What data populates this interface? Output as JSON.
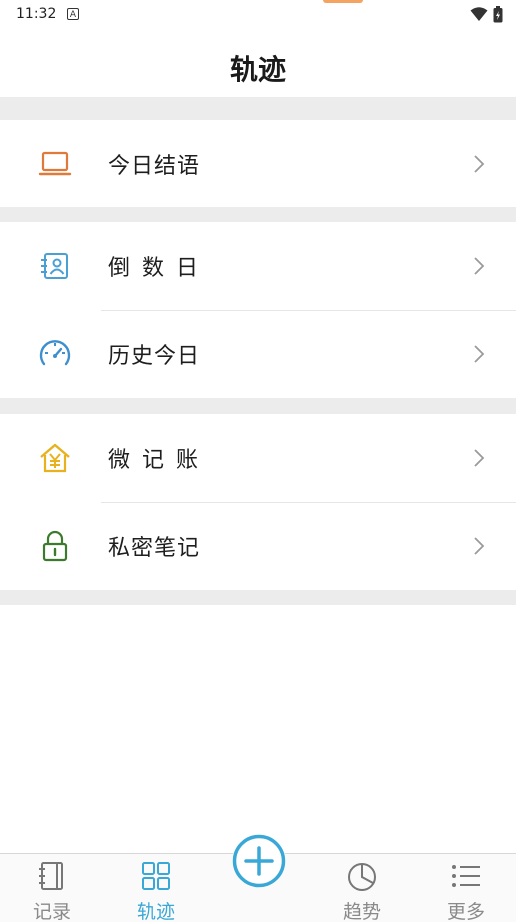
{
  "status": {
    "time": "11:32",
    "notify_glyph": "A"
  },
  "header": {
    "title": "轨迹"
  },
  "sections": [
    {
      "items": [
        {
          "label": "今日结语",
          "icon": "laptop-icon"
        }
      ]
    },
    {
      "items": [
        {
          "label": "倒数日",
          "icon": "contact-card-icon"
        },
        {
          "label": "历史今日",
          "icon": "speedometer-icon"
        }
      ]
    },
    {
      "items": [
        {
          "label": "微记账",
          "icon": "yen-house-icon"
        },
        {
          "label": "私密笔记",
          "icon": "lock-icon"
        }
      ]
    }
  ],
  "tabs": [
    {
      "label": "记录",
      "icon": "notebook-icon",
      "active": false
    },
    {
      "label": "轨迹",
      "icon": "grid-icon",
      "active": true
    },
    {
      "label": "趋势",
      "icon": "pie-chart-icon",
      "active": false
    },
    {
      "label": "更多",
      "icon": "list-icon",
      "active": false
    }
  ],
  "fab": {
    "icon": "plus-circle-icon"
  },
  "colors": {
    "accent": "#3aa8d6",
    "laptop": "#e07a3a",
    "contact": "#4a9fd4",
    "speed": "#3d8fcf",
    "yen": "#e8b21e",
    "lock": "#3c7a2e"
  }
}
